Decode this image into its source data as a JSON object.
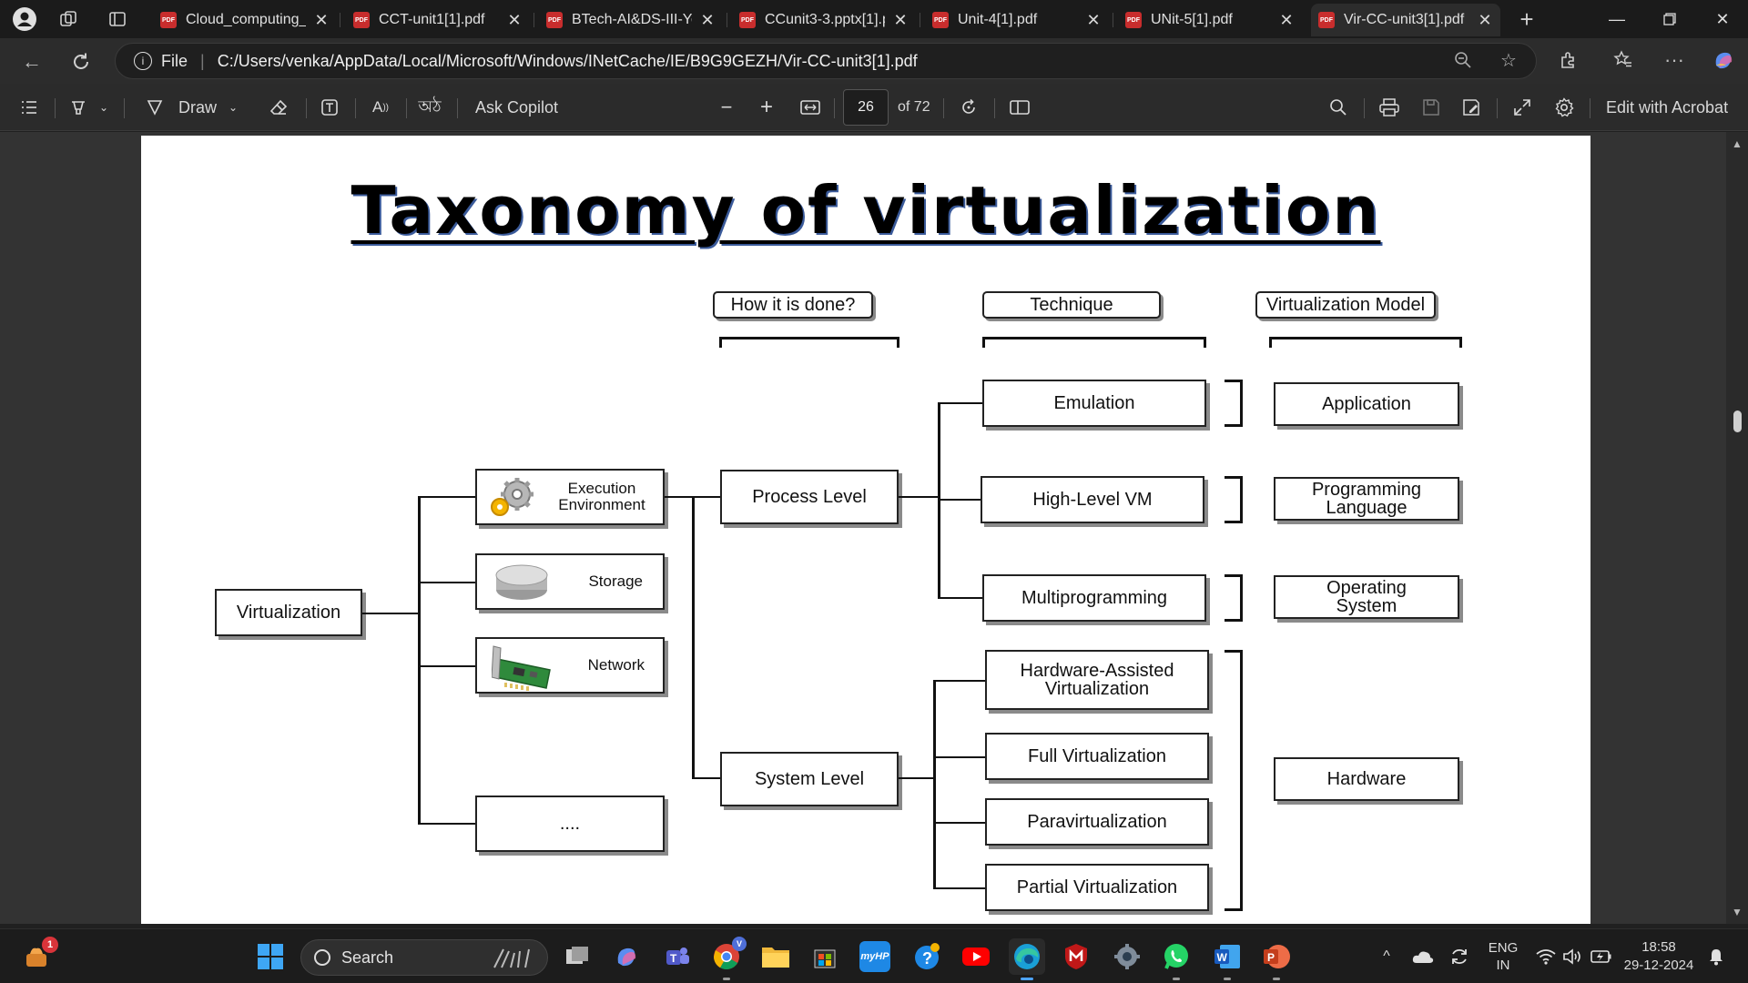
{
  "browser": {
    "tabs": [
      {
        "label": "Cloud_computing_u",
        "active": false
      },
      {
        "label": "CCT-unit1[1].pdf",
        "active": false
      },
      {
        "label": "BTech-AI&DS-III-Yea",
        "active": false
      },
      {
        "label": "CCunit3-3.pptx[1].pd",
        "active": false
      },
      {
        "label": "Unit-4[1].pdf",
        "active": false
      },
      {
        "label": "UNit-5[1].pdf",
        "active": false
      },
      {
        "label": "Vir-CC-unit3[1].pdf",
        "active": true
      }
    ],
    "address": {
      "scheme": "File",
      "url": "C:/Users/venka/AppData/Local/Microsoft/Windows/INetCache/IE/B9G9GEZH/Vir-CC-unit3[1].pdf"
    }
  },
  "pdf_toolbar": {
    "draw_label": "Draw",
    "ask_copilot_label": "Ask Copilot",
    "page_number": "26",
    "page_total": "of 72",
    "edit_acrobat_label": "Edit with Acrobat"
  },
  "slide": {
    "title": "Taxonomy of virtualization",
    "headers": {
      "how": "How it is done?",
      "technique": "Technique",
      "model": "Virtualization Model"
    },
    "root": "Virtualization",
    "categories": {
      "execution": "Execution Environment",
      "storage": "Storage",
      "network": "Network",
      "more": "...."
    },
    "levels": {
      "process": "Process Level",
      "system": "System Level"
    },
    "techniques": {
      "emulation": "Emulation",
      "hlvm": "High-Level VM",
      "multiprog": "Multiprogramming",
      "hwassist": "Hardware-Assisted Virtualization",
      "full": "Full Virtualization",
      "para": "Paravirtualization",
      "partial": "Partial Virtualization"
    },
    "models": {
      "application": "Application",
      "proglang": "Programming Language",
      "os": "Operating System",
      "hardware": "Hardware"
    }
  },
  "taskbar": {
    "search_label": "Search",
    "notification_count": "1",
    "language_line1": "ENG",
    "language_line2": "IN",
    "time": "18:58",
    "date": "29-12-2024"
  }
}
